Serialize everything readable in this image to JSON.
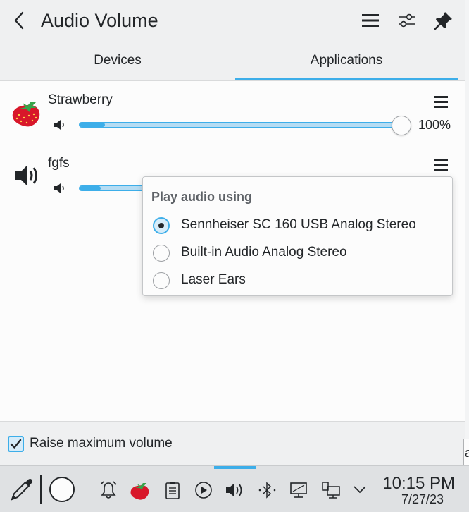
{
  "header": {
    "title": "Audio Volume",
    "back_icon": "chevron-left-icon",
    "menu_icon": "hamburger-menu-icon",
    "configure_icon": "sliders-icon",
    "pin_icon": "pin-icon"
  },
  "tabs": [
    {
      "label": "Devices",
      "active": false
    },
    {
      "label": "Applications",
      "active": true
    }
  ],
  "applications": [
    {
      "name": "Strawberry",
      "icon": "strawberry-icon",
      "volume_percent": 100,
      "volume_label": "100%",
      "level_fill": 0.08
    },
    {
      "name": "fgfs",
      "icon": "speaker-icon",
      "volume_percent": null
    }
  ],
  "output_menu": {
    "heading": "Play audio using",
    "options": [
      {
        "label": "Sennheiser SC 160 USB Analog Stereo",
        "selected": true
      },
      {
        "label": "Built-in Audio Analog Stereo",
        "selected": false
      },
      {
        "label": "Laser Ears",
        "selected": false
      }
    ]
  },
  "footer": {
    "raise_max_volume_label": "Raise maximum volume",
    "raise_max_volume_checked": true
  },
  "background_window": {
    "visible_text": "a"
  },
  "taskbar": {
    "tray_icons": [
      "color-picker-icon",
      "circle-icon",
      "alarm-icon",
      "strawberry-icon",
      "clipboard-icon",
      "media-play-icon",
      "volume-icon",
      "bluetooth-icon",
      "display-icon",
      "network-icon",
      "chevron-down-icon"
    ],
    "time": "10:15 PM",
    "date": "7/27/23"
  },
  "colors": {
    "accent": "#3daee9",
    "panel_bg": "#eff0f1",
    "content_bg": "#fcfcfc",
    "text": "#232629",
    "taskbar_bg": "#dfe1e3"
  }
}
